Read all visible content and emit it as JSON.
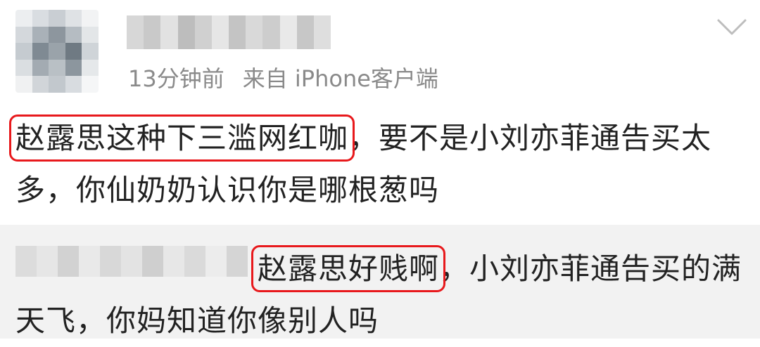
{
  "post": {
    "timestamp": "13分钟前",
    "source": "来自 iPhone客户端",
    "highlight": "赵露思这种下三滥网红咖",
    "body_rest": "，要不是小刘亦菲通告买太多，你仙奶奶认识你是哪根葱吗"
  },
  "reply": {
    "highlight": "赵露思好贱啊",
    "body_rest": "，小刘亦菲通告买的满天飞，你妈知道你像别人吗"
  },
  "colors": {
    "highlight_border": "#e8191c",
    "reply_background": "#f2f2f2",
    "meta_text": "#8a8a8a"
  },
  "icons": {
    "dropdown": "chevron-down-icon"
  }
}
